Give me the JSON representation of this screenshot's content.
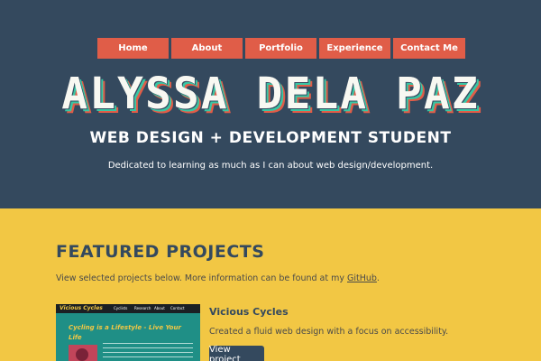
{
  "colors": {
    "hero_bg": "#34495e",
    "accent": "#e05d48",
    "teal": "#38c6a4",
    "page_bg": "#f2c744"
  },
  "nav": {
    "items": [
      {
        "label": "Home"
      },
      {
        "label": "About"
      },
      {
        "label": "Portfolio"
      },
      {
        "label": "Experience"
      },
      {
        "label": "Contact Me"
      }
    ]
  },
  "hero": {
    "name": "ALYSSA DELA PAZ",
    "subtitle": "WEB DESIGN + DEVELOPMENT STUDENT",
    "tagline": "Dedicated to learning as much as I can about web design/development."
  },
  "featured": {
    "title": "FEATURED PROJECTS",
    "intro_text": "View selected projects below. More information can be found at my ",
    "intro_link": "GitHub",
    "intro_end": ".",
    "projects": [
      {
        "name": "Vicious Cycles",
        "description": "Created a fluid web design with a focus on accessibility.",
        "button_label": "View project",
        "thumbnail": {
          "logo": "Vicious Cycles",
          "nav": [
            "Cyclists",
            "Research",
            "About",
            "Contact"
          ],
          "heading": "Cycling is a Lifestyle - Live Your Life"
        }
      }
    ]
  }
}
